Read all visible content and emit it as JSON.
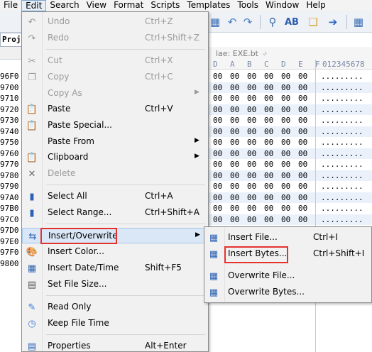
{
  "menubar": [
    {
      "label": "File",
      "active": false
    },
    {
      "label": "Edit",
      "active": true
    },
    {
      "label": "Search",
      "active": false
    },
    {
      "label": "View",
      "active": false
    },
    {
      "label": "Format",
      "active": false
    },
    {
      "label": "Scripts",
      "active": false
    },
    {
      "label": "Templates",
      "active": false
    },
    {
      "label": "Tools",
      "active": false
    },
    {
      "label": "Window",
      "active": false
    },
    {
      "label": "Help",
      "active": false
    }
  ],
  "project_label": "Proj",
  "file_tab": "lae: EXE.bt",
  "hex_header": [
    "D",
    "A",
    "B",
    "C",
    "D",
    "E",
    "F"
  ],
  "ascii_header": "012345678",
  "addresses": [
    "96F0",
    "9700",
    "9710",
    "9720",
    "9730",
    "9740",
    "9750",
    "9760",
    "9770",
    "9780",
    "9790",
    "97A0",
    "97B0",
    "97C0",
    "97D0",
    "97E0",
    "97F0",
    "9800"
  ],
  "hex_byte": "00",
  "ascii_dots": ".........",
  "edit_menu": {
    "items": [
      {
        "id": "undo",
        "label": "Undo",
        "shortcut": "Ctrl+Z",
        "icon": "undo-icon",
        "glyph": "↶",
        "disabled": true,
        "submenu": false
      },
      {
        "id": "redo",
        "label": "Redo",
        "shortcut": "Ctrl+Shift+Z",
        "icon": "redo-icon",
        "glyph": "↷",
        "disabled": true,
        "submenu": false
      },
      {
        "id": "cut",
        "label": "Cut",
        "shortcut": "Ctrl+X",
        "icon": "scissors-icon",
        "glyph": "✂",
        "disabled": true,
        "submenu": false
      },
      {
        "id": "copy",
        "label": "Copy",
        "shortcut": "Ctrl+C",
        "icon": "copy-icon",
        "glyph": "❐",
        "disabled": true,
        "submenu": false
      },
      {
        "id": "copy-as",
        "label": "Copy As",
        "shortcut": "",
        "icon": "",
        "glyph": "",
        "disabled": true,
        "submenu": true
      },
      {
        "id": "paste",
        "label": "Paste",
        "shortcut": "Ctrl+V",
        "icon": "clipboard-paste-icon",
        "glyph": "📋",
        "disabled": false,
        "submenu": false
      },
      {
        "id": "paste-special",
        "label": "Paste Special...",
        "shortcut": "",
        "icon": "paste-special-icon",
        "glyph": "📋",
        "disabled": false,
        "submenu": false
      },
      {
        "id": "paste-from",
        "label": "Paste From",
        "shortcut": "",
        "icon": "",
        "glyph": "",
        "disabled": false,
        "submenu": true
      },
      {
        "id": "clipboard",
        "label": "Clipboard",
        "shortcut": "",
        "icon": "clipboard-icon",
        "glyph": "📋",
        "disabled": false,
        "submenu": true
      },
      {
        "id": "delete",
        "label": "Delete",
        "shortcut": "",
        "icon": "delete-x-icon",
        "glyph": "✕",
        "disabled": true,
        "submenu": false
      },
      {
        "id": "select-all",
        "label": "Select All",
        "shortcut": "Ctrl+A",
        "icon": "select-all-icon",
        "glyph": "▮",
        "disabled": false,
        "submenu": false
      },
      {
        "id": "select-range",
        "label": "Select Range...",
        "shortcut": "Ctrl+Shift+A",
        "icon": "select-range-icon",
        "glyph": "▮",
        "disabled": false,
        "submenu": false
      },
      {
        "id": "insert-overwrite",
        "label": "Insert/Overwrite",
        "shortcut": "",
        "icon": "insert-overwrite-icon",
        "glyph": "⇆",
        "disabled": false,
        "submenu": true
      },
      {
        "id": "insert-color",
        "label": "Insert Color...",
        "shortcut": "",
        "icon": "color-palette-icon",
        "glyph": "🎨",
        "disabled": false,
        "submenu": false
      },
      {
        "id": "insert-date-time",
        "label": "Insert Date/Time",
        "shortcut": "Shift+F5",
        "icon": "calendar-icon",
        "glyph": "▦",
        "disabled": false,
        "submenu": false
      },
      {
        "id": "set-file-size",
        "label": "Set File Size...",
        "shortcut": "",
        "icon": "eof-icon",
        "glyph": "▤",
        "disabled": false,
        "submenu": false
      },
      {
        "id": "read-only",
        "label": "Read Only",
        "shortcut": "",
        "icon": "pencil-icon",
        "glyph": "✎",
        "disabled": false,
        "submenu": false
      },
      {
        "id": "keep-file-time",
        "label": "Keep File Time",
        "shortcut": "",
        "icon": "clock-icon",
        "glyph": "◷",
        "disabled": false,
        "submenu": false
      },
      {
        "id": "properties",
        "label": "Properties",
        "shortcut": "Alt+Enter",
        "icon": "properties-icon",
        "glyph": "▤",
        "disabled": false,
        "submenu": false
      }
    ]
  },
  "insert_submenu": {
    "items": [
      {
        "id": "insert-file",
        "label": "Insert File...",
        "shortcut": "Ctrl+I",
        "icon": "insert-file-icon",
        "glyph": "▦"
      },
      {
        "id": "insert-bytes",
        "label": "Insert Bytes...",
        "shortcut": "Ctrl+Shift+I",
        "icon": "insert-bytes-icon",
        "glyph": "▦"
      },
      {
        "id": "overwrite-file",
        "label": "Overwrite File...",
        "shortcut": "",
        "icon": "overwrite-file-icon",
        "glyph": "▦"
      },
      {
        "id": "overwrite-bytes",
        "label": "Overwrite Bytes...",
        "shortcut": "",
        "icon": "overwrite-bytes-icon",
        "glyph": "▦"
      }
    ]
  },
  "colors": {
    "highlight_box": "#e5322f",
    "hover_bg": "#dae7f6",
    "row_alt": "#eaf1fb"
  }
}
